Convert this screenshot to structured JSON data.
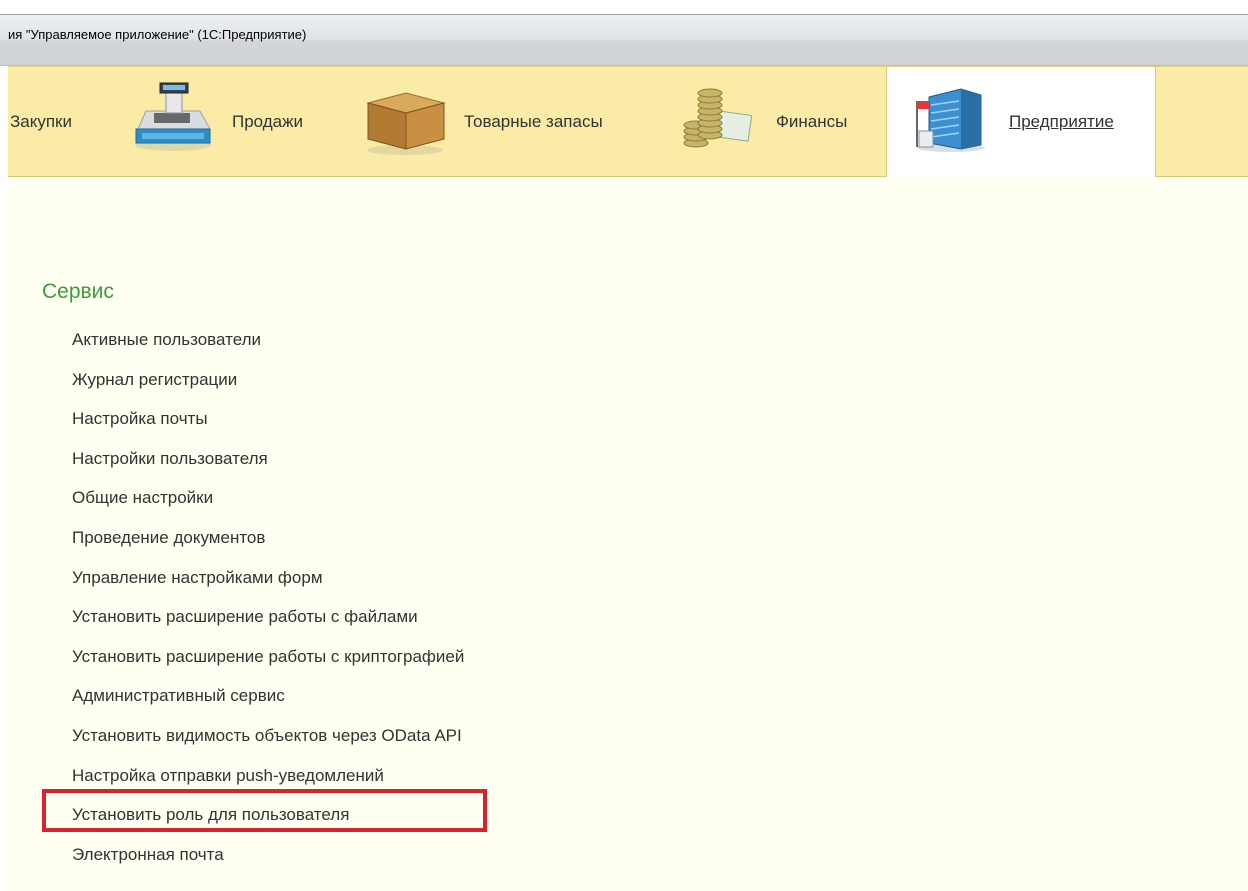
{
  "window": {
    "title": "ия \"Управляемое приложение\"  (1С:Предприятие)"
  },
  "sections": [
    {
      "label": "Закупки",
      "icon": "purchases-icon",
      "active": false
    },
    {
      "label": "Продажи",
      "icon": "cash-register-icon",
      "active": false
    },
    {
      "label": "Товарные запасы",
      "icon": "box-icon",
      "active": false
    },
    {
      "label": "Финансы",
      "icon": "coins-icon",
      "active": false
    },
    {
      "label": "Предприятие",
      "icon": "office-building-icon",
      "active": true
    }
  ],
  "service": {
    "title": "Сервис",
    "items": [
      "Активные пользователи",
      "Журнал регистрации",
      "Настройка почты",
      "Настройки пользователя",
      "Общие настройки",
      "Проведение документов",
      "Управление настройками форм",
      "Установить расширение работы с файлами",
      "Установить расширение работы с криптографией",
      "Административный сервис",
      "Установить видимость объектов через OData API",
      "Настройка отправки push-уведомлений",
      "Установить роль для пользователя",
      "Электронная почта"
    ],
    "highlighted_item": "Установить роль для пользователя"
  },
  "colors": {
    "sections_bar": "#faeca6",
    "content_bg": "#fffff2",
    "group_title": "#3a9e3a",
    "highlight": "#d8232e"
  }
}
